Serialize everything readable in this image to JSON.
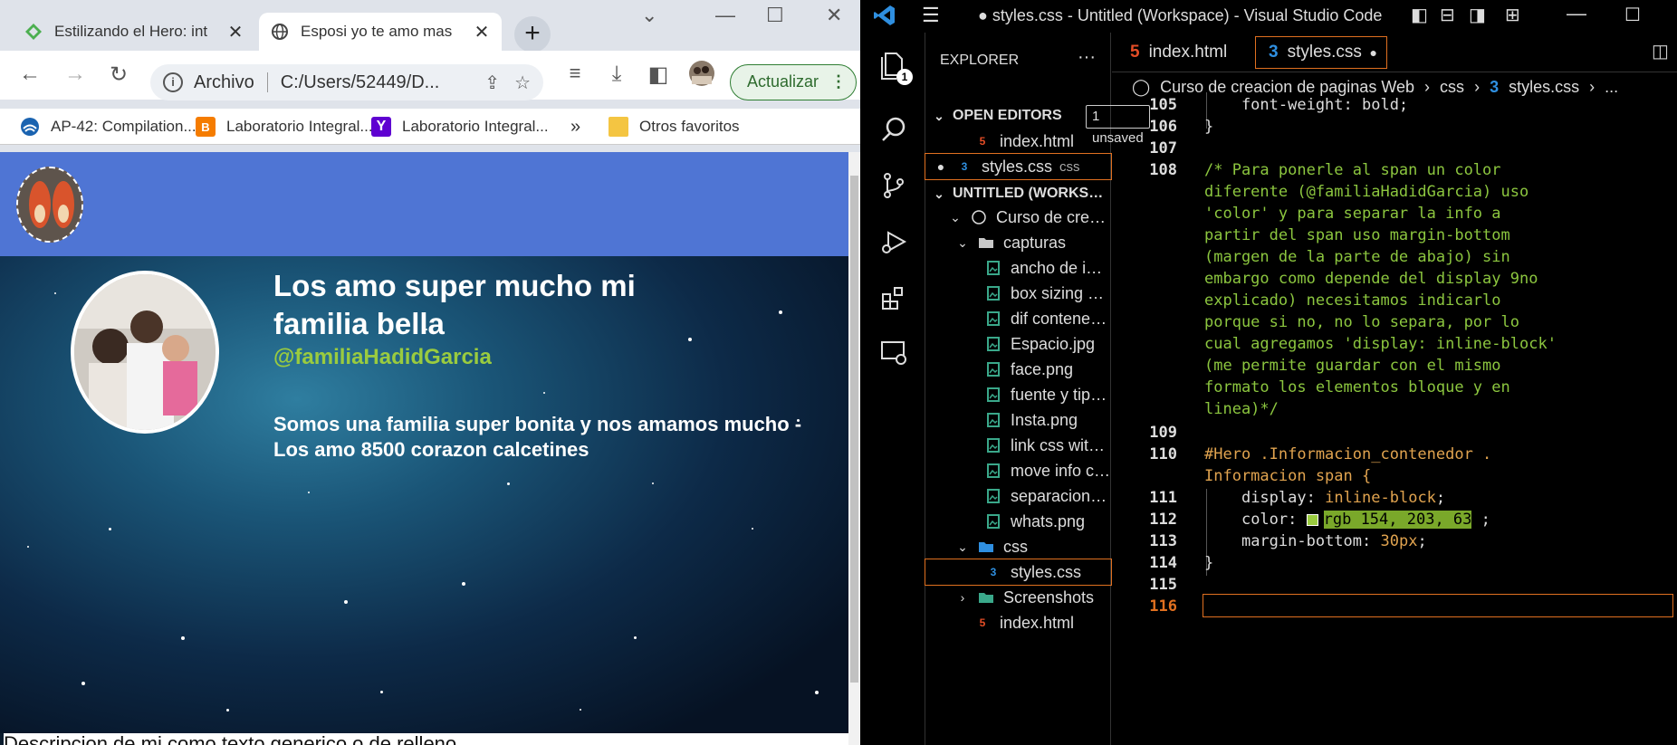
{
  "browser": {
    "tabs": [
      {
        "title": "Estilizando el Hero: int",
        "favicon": "green-diamond-icon"
      },
      {
        "title": "Esposi yo te amo mas",
        "favicon": "globe-icon"
      }
    ],
    "address": {
      "scheme_label": "Archivo",
      "path": "C:/Users/52449/D..."
    },
    "update_label": "Actualizar",
    "bookmarks": [
      {
        "label": "AP-42: Compilation...",
        "icon": "epa-icon",
        "color": "#1a63b0"
      },
      {
        "label": "Laboratorio Integral...",
        "icon": "blogger-icon",
        "color": "#f57c00"
      },
      {
        "label": "Laboratorio Integral...",
        "icon": "yahoo-icon",
        "color": "#5f01d1"
      }
    ],
    "other_bookmarks": "Otros favoritos",
    "page": {
      "hero_title": "Los amo super mucho mi familia bella",
      "hero_handle": "@familiaHadidGarcia",
      "hero_description": "Somos una familia super bonita y nos amamos mucho - Los amo 8500 corazon calcetines",
      "footer_text": "Descripcion de mi como texto generico o de relleno",
      "header_color": "#4f75d4",
      "handle_color": "#9acb3f"
    }
  },
  "vscode": {
    "title": "● styles.css - Untitled (Workspace) - Visual Studio Code",
    "explorer_label": "EXPLORER",
    "explorer_more": "···",
    "source_control_badge": "1",
    "open_editors": {
      "label": "OPEN EDITORS",
      "badge": "1 unsaved",
      "items": [
        {
          "name": "index.html",
          "kind": "html",
          "dirty": false,
          "detail": ""
        },
        {
          "name": "styles.css",
          "kind": "css",
          "dirty": true,
          "detail": "css"
        }
      ]
    },
    "workspace": {
      "label": "UNTITLED (WORKSPACE)",
      "root": "Curso de creacion...",
      "capturas_folder": "capturas",
      "capturas_files": [
        "ancho de img ...",
        "box sizing bor...",
        "dif contenedor...",
        "Espacio.jpg",
        "face.png",
        "fuente y tipo d...",
        "Insta.png",
        "link css with ht...",
        "move info cont...",
        "separacion img...",
        "whats.png"
      ],
      "css_folder": "css",
      "css_files": [
        "styles.css"
      ],
      "screenshots_folder": "Screenshots",
      "root_files": [
        "index.html"
      ]
    },
    "editor_tabs": [
      {
        "name": "index.html",
        "kind": "html",
        "active": false
      },
      {
        "name": "styles.css",
        "kind": "css",
        "active": true,
        "dirty": true
      }
    ],
    "breadcrumb": [
      "Curso de creacion de paginas Web",
      "css",
      "styles.css",
      "..."
    ],
    "code": {
      "line_numbers": [
        "105",
        "106",
        "107",
        "108",
        "109",
        "110",
        "111",
        "112",
        "113",
        "114",
        "115",
        "116"
      ],
      "line105": "    font-weight: bold;",
      "line106": "}",
      "comment_lines": [
        "/* Para ponerle al span un color",
        "diferente (@familiaHadidGarcia) uso",
        "'color' y para separar la info a",
        "partir del span uso margin-bottom",
        "(margen de la parte de abajo) sin",
        "embargo como depende del display 9no",
        "explicado) necesitamos indicarlo",
        "porque si no, no lo separa, por lo",
        "cual agregamos 'display: inline-block'",
        "(me permite guardar con el mismo",
        "formato los elementos bloque y en",
        "linea)*/"
      ],
      "selector_line1": "#Hero .Informacion_contenedor .",
      "selector_line2": "Informacion span {",
      "prop_display": "display",
      "val_display": "inline-block",
      "prop_color": "color",
      "val_color": "rgb 154, 203, 63",
      "prop_margin": "margin-bottom",
      "val_margin": "30px",
      "close_brace": "}"
    }
  }
}
